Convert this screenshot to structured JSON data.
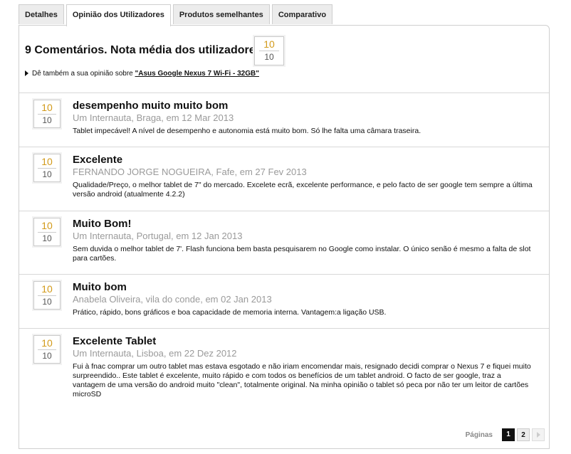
{
  "tabs": [
    {
      "label": "Detalhes",
      "active": false
    },
    {
      "label": "Opinião dos Utilizadores",
      "active": true
    },
    {
      "label": "Produtos semelhantes",
      "active": false
    },
    {
      "label": "Comparativo",
      "active": false
    }
  ],
  "summary": {
    "title": "9 Comentários. Nota média dos utilizadores:",
    "rating": "10",
    "rating_max": "10",
    "opinion_prefix": "Dê também a sua opinião sobre ",
    "opinion_link": "\"Asus Google Nexus 7 Wi-Fi - 32GB\""
  },
  "reviews": [
    {
      "rating": "10",
      "rating_max": "10",
      "title": "desempenho muito muito bom",
      "meta": "Um Internauta, Braga, em 12 Mar 2013",
      "text": "Tablet impecável! A nível de desempenho e autonomia está muito bom. Só lhe falta uma câmara traseira."
    },
    {
      "rating": "10",
      "rating_max": "10",
      "title": "Excelente",
      "meta": "FERNANDO JORGE NOGUEIRA, Fafe, em 27 Fev 2013",
      "text": "Qualidade/Preço, o melhor tablet de 7\" do mercado. Excelete ecrã, excelente performance, e pelo facto de ser google tem sempre a última versão android (atualmente 4.2.2)"
    },
    {
      "rating": "10",
      "rating_max": "10",
      "title": "Muito Bom!",
      "meta": "Um Internauta, Portugal, em 12 Jan 2013",
      "text": "Sem duvida o melhor tablet de 7'. Flash funciona bem basta pesquisarem no Google como instalar. O único senão é mesmo a falta de slot para cartões."
    },
    {
      "rating": "10",
      "rating_max": "10",
      "title": "Muito bom",
      "meta": "Anabela Oliveira, vila do conde, em 02 Jan 2013",
      "text": "Prático, rápido, bons gráficos e boa capacidade de memoria interna. Vantagem:a ligação USB."
    },
    {
      "rating": "10",
      "rating_max": "10",
      "title": "Excelente Tablet",
      "meta": "Um Internauta, Lisboa, em 22 Dez 2012",
      "text": "Fui à fnac comprar um outro tablet mas estava esgotado e não iriam encomendar mais, resignado decidi comprar o Nexus 7 e fiquei muito surpreendido.. Este tablet é excelente, muito rápido e com todos os benefícios de um tablet android. O facto de ser google, traz a vantagem de uma versão do android muito \"clean\", totalmente original. Na minha opinião o tablet só peca por não ter um leitor de cartões microSD"
    }
  ],
  "pagination": {
    "label": "Páginas",
    "pages": [
      "1",
      "2"
    ],
    "current": "1"
  }
}
